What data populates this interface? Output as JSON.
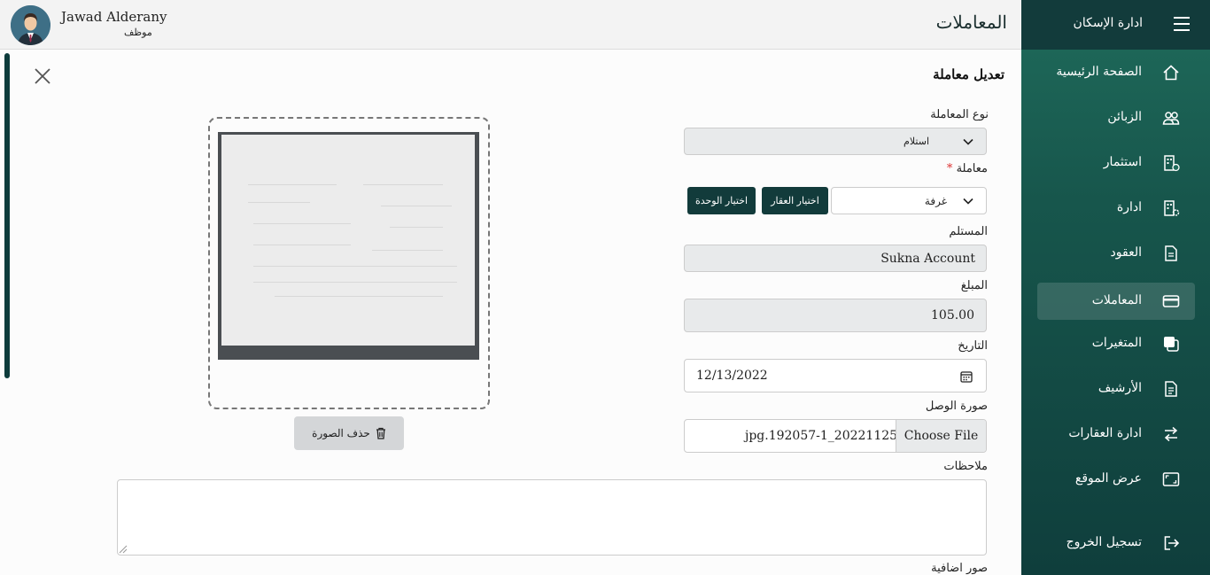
{
  "sidebar": {
    "title": "ادارة الإسكان",
    "items": [
      {
        "label": "الصفحة الرئيسية",
        "icon": "home-icon"
      },
      {
        "label": "الزبائن",
        "icon": "users-icon"
      },
      {
        "label": "استثمار",
        "icon": "building-dollar-icon"
      },
      {
        "label": "ادارة",
        "icon": "building-gear-icon"
      },
      {
        "label": "العقود",
        "icon": "document-icon"
      },
      {
        "label": "المعاملات",
        "icon": "card-icon"
      },
      {
        "label": "المتغيرات",
        "icon": "copy-icon"
      },
      {
        "label": "الأرشيف",
        "icon": "archive-doc-icon"
      },
      {
        "label": "ادارة العقارات",
        "icon": "arrows-exchange-icon"
      },
      {
        "label": "عرض الموقع",
        "icon": "screen-icon"
      },
      {
        "label": "تسجيل الخروج",
        "icon": "logout-icon"
      }
    ],
    "active_index": 5
  },
  "header": {
    "title": "المعاملات",
    "user_name": "Jawad Alderany",
    "user_role": "موظف"
  },
  "form": {
    "title": "تعديل معاملة",
    "type_label": "نوع المعاملة",
    "type_value": "استلام",
    "transaction_label": "معاملة",
    "required_mark": "*",
    "transaction_value": "غرفة",
    "choose_property": "اختيار العقار",
    "choose_unit": "اختيار الوحدة",
    "recipient_label": "المستلم",
    "recipient_value": "Sukna Account",
    "amount_label": "المبلغ",
    "amount_value": "105.00",
    "date_label": "التاريخ",
    "date_value": "12/13/2022",
    "receipt_label": "صورة الوصل",
    "file_button": "Choose File",
    "file_name": "jpg.192057-1_20221125",
    "delete_image": "حذف الصورة",
    "notes_label": "ملاحظات",
    "extra_images_label": "صور اضافية"
  }
}
